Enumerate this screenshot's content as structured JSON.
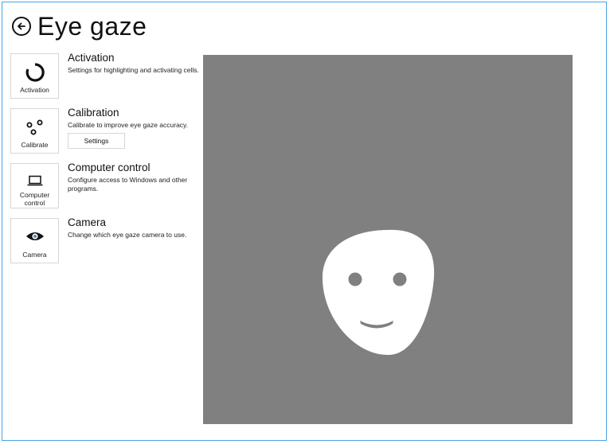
{
  "header": {
    "title": "Eye gaze",
    "back_icon": "back-arrow-circle-icon"
  },
  "items": [
    {
      "tile_label": "Activation",
      "heading": "Activation",
      "description": "Settings for highlighting and activating cells.",
      "icon": "activation-ring-icon"
    },
    {
      "tile_label": "Calibrate",
      "heading": "Calibration",
      "description": "Calibrate to improve eye gaze accuracy.",
      "button_label": "Settings",
      "icon": "calibration-dots-icon"
    },
    {
      "tile_label": "Computer control",
      "heading": "Computer control",
      "description": "Configure access to Windows and other programs.",
      "icon": "laptop-icon"
    },
    {
      "tile_label": "Camera",
      "heading": "Camera",
      "description": "Change which eye gaze camera to use.",
      "icon": "eye-icon"
    }
  ],
  "preview": {
    "background_color": "#808080",
    "face_color": "#ffffff",
    "feature_color": "#808080"
  },
  "colors": {
    "frame_border": "#4aa3e0",
    "tile_border": "#d6d6d6"
  }
}
